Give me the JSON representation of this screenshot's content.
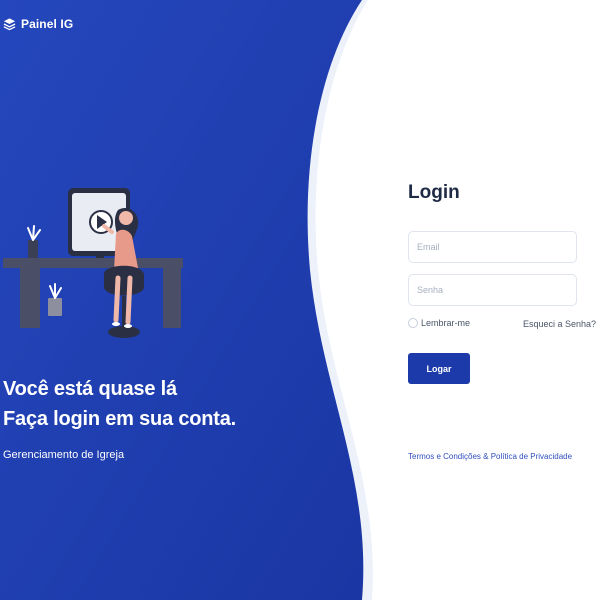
{
  "brand": {
    "name": "Painel IG",
    "icon": "layers-icon"
  },
  "hero": {
    "headline_line1": "Você está quase lá",
    "headline_line2": "Faça login em sua conta.",
    "subtitle": "Gerenciamento de Igreja",
    "illustration": "person-at-desk-watching-video-illustration"
  },
  "login": {
    "title": "Login",
    "email_placeholder": "Email",
    "email_value": "",
    "password_placeholder": "Senha",
    "password_value": "",
    "remember_label": "Lembrar-me",
    "remember_checked": false,
    "forgot_label": "Esqueci a Senha?",
    "submit_label": "Logar",
    "terms_label": "Termos e Condições & Política de Privacidade"
  },
  "colors": {
    "panel_blue": "#1c3aa9",
    "panel_blue_light": "#2445b8",
    "form_background": "#ffffff",
    "primary_button": "#1c3aa9",
    "link": "#2f4fbf",
    "text_dark": "#1f2a44"
  }
}
